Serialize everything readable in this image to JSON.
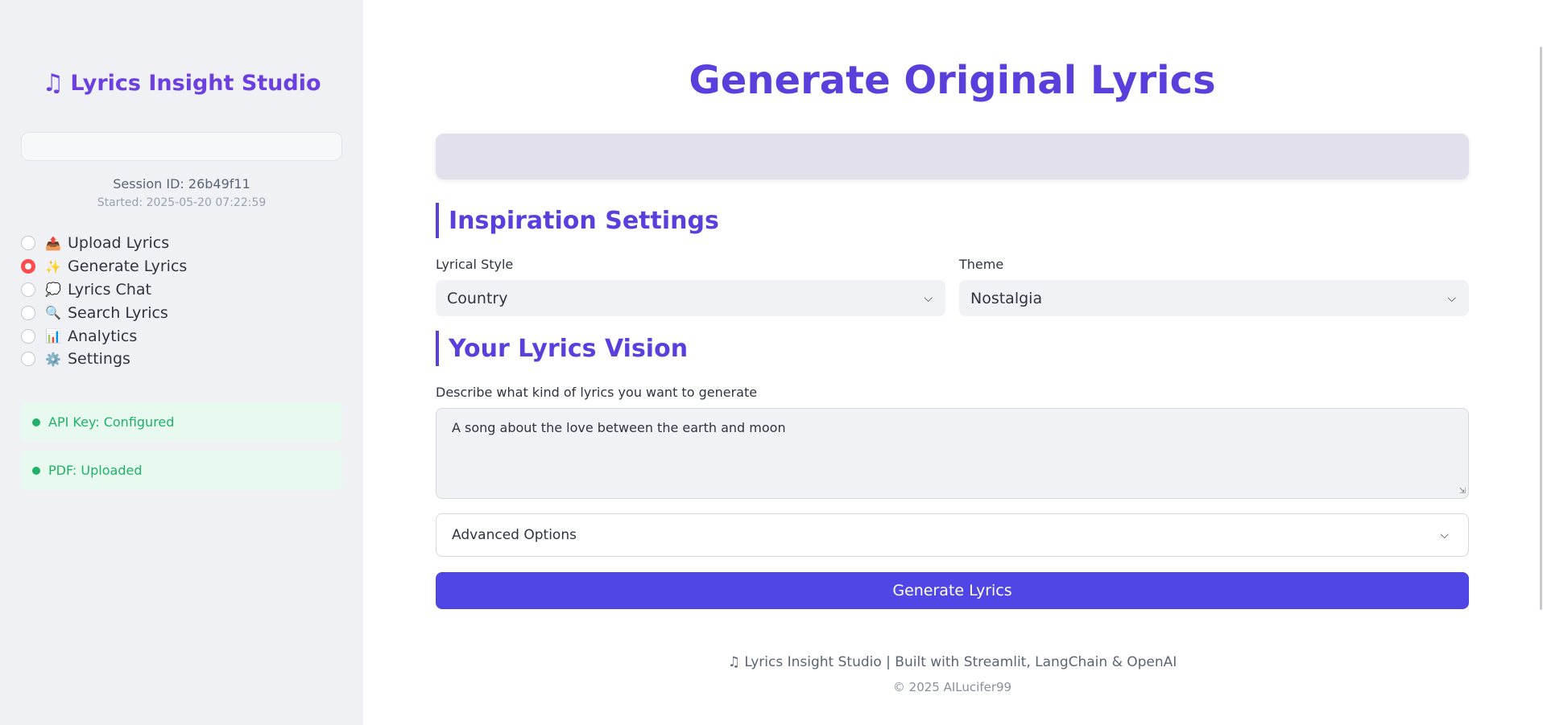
{
  "sidebar": {
    "brand": "Lyrics Insight Studio",
    "brand_icon": "♫",
    "session_id": "Session ID: 26b49f11",
    "session_started": "Started: 2025-05-20 07:22:59",
    "nav": [
      {
        "label": "Upload Lyrics",
        "emoji": "📤",
        "selected": false
      },
      {
        "label": "Generate Lyrics",
        "emoji": "✨",
        "selected": true
      },
      {
        "label": "Lyrics Chat",
        "emoji": "💭",
        "selected": false
      },
      {
        "label": "Search Lyrics",
        "emoji": "🔍",
        "selected": false
      },
      {
        "label": "Analytics",
        "emoji": "📊",
        "selected": false
      },
      {
        "label": "Settings",
        "emoji": "⚙️",
        "selected": false
      }
    ],
    "status": {
      "api_key": "API Key: Configured",
      "pdf": "PDF: Uploaded"
    }
  },
  "main": {
    "title": "Generate Original Lyrics",
    "inspiration_heading": "Inspiration Settings",
    "style_label": "Lyrical Style",
    "style_value": "Country",
    "theme_label": "Theme",
    "theme_value": "Nostalgia",
    "vision_heading": "Your Lyrics Vision",
    "vision_label": "Describe what kind of lyrics you want to generate",
    "vision_value": "A song about the love between the earth and moon",
    "advanced_label": "Advanced Options",
    "generate_button": "Generate Lyrics"
  },
  "footer": {
    "line": "♫ Lyrics Insight Studio | Built with Streamlit, LangChain & OpenAI",
    "copyright": "© 2025 AILucifer99"
  },
  "colors": {
    "accent": "#5b3fdc",
    "button": "#4f46e5",
    "radio_selected": "#ff4b4b",
    "status_green": "#21b06a"
  }
}
